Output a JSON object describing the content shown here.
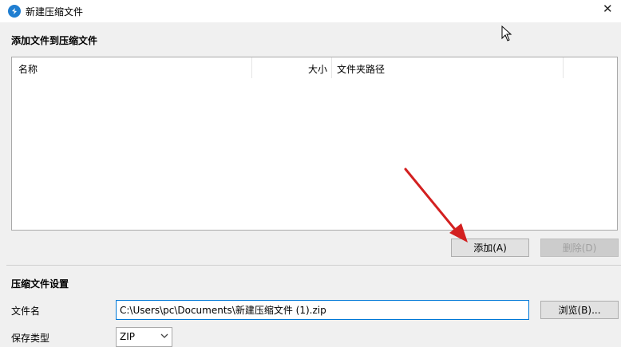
{
  "window": {
    "title": "新建压缩文件",
    "app_icon": "app-logo-icon",
    "close_icon": "close-icon"
  },
  "add_section": {
    "title": "添加文件到压缩文件",
    "columns": [
      "名称",
      "大小",
      "文件夹路径"
    ],
    "add_button": "添加(A)",
    "delete_button": "删除(D)"
  },
  "settings_section": {
    "title": "压缩文件设置",
    "filename_label": "文件名",
    "filename_value": "C:\\Users\\pc\\Documents\\新建压缩文件 (1).zip",
    "browse_button": "浏览(B)...",
    "type_label": "保存类型",
    "type_value": "ZIP"
  },
  "colors": {
    "accent": "#0078d7",
    "annotation_arrow": "#d32020"
  }
}
